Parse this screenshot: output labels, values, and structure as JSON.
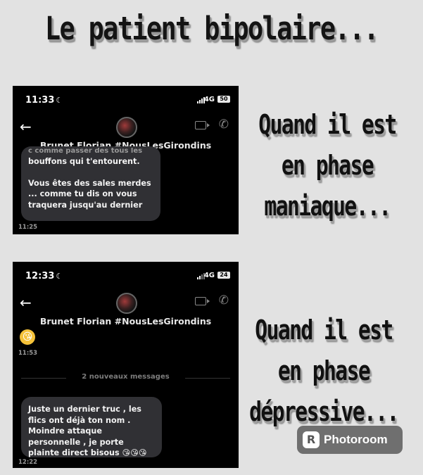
{
  "meme": {
    "title": "Le patient bipolaire...",
    "caption_manic": [
      "Quand il est",
      "en phase",
      "maniaque..."
    ],
    "caption_depressive": [
      "Quand il est",
      "en phase",
      "dépressive..."
    ]
  },
  "screenshot_1": {
    "status_time": "11:33",
    "network": "4G",
    "battery": "50",
    "contact_name": "Brunet Florian #NousLesGirondins",
    "cut_off_line": "c comme passer des tous les",
    "message_paragraph_1": "bouffons qui t'entourent.",
    "message_paragraph_2": "Vous êtes des sales merdes ... comme tu dis on vous traquera jusqu'au dernier",
    "message_time": "11:25"
  },
  "screenshot_2": {
    "status_time": "12:33",
    "network": "4G",
    "battery": "24",
    "contact_name": "Brunet Florian #NousLesGirondins",
    "emoji_message": "😘",
    "emoji_time": "11:53",
    "new_messages_divider": "2 nouveaux messages",
    "message": "Juste un dernier truc , les flics ont déjà ton nom . Moindre attaque personnelle , je porte plainte direct bisous 😘😘😘",
    "message_time": "12:22"
  },
  "watermark": {
    "logo": "R",
    "text": "Photoroom"
  },
  "icons": [
    "moon-icon",
    "signal-icon",
    "battery-icon",
    "back-arrow-icon",
    "video-call-icon",
    "phone-call-icon",
    "avatar",
    "photoroom-logo-icon"
  ]
}
